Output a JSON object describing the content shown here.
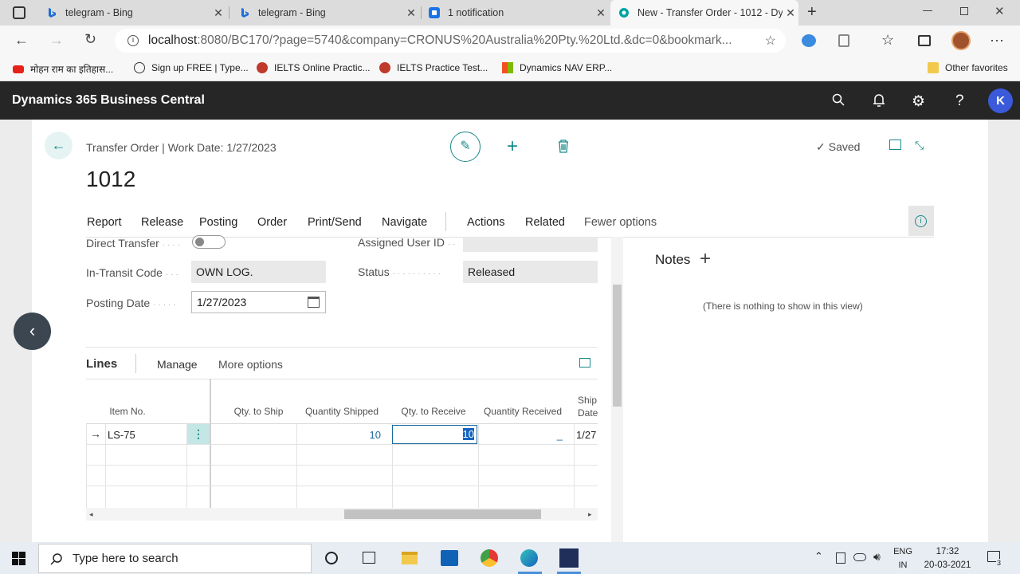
{
  "browser": {
    "tabs": [
      {
        "title": "telegram - Bing"
      },
      {
        "title": "telegram - Bing"
      },
      {
        "title": "1 notification"
      },
      {
        "title": "New - Transfer Order - 1012 - Dy"
      }
    ],
    "url_host": "localhost",
    "url_rest": ":8080/BC170/?page=5740&company=CRONUS%20Australia%20Pty.%20Ltd.&dc=0&bookmark...",
    "favorites": [
      {
        "label": "मोहन राम का इतिहास..."
      },
      {
        "label": "Sign up FREE | Type..."
      },
      {
        "label": "IELTS Online Practic..."
      },
      {
        "label": "IELTS Practice Test..."
      },
      {
        "label": "Dynamics NAV ERP..."
      }
    ],
    "other_favorites": "Other favorites"
  },
  "app": {
    "title": "Dynamics 365 Business Central",
    "avatar_initial": "K"
  },
  "page": {
    "breadcrumb": "Transfer Order | Work Date: 1/27/2023",
    "record_no": "1012",
    "saved": "Saved",
    "actions": [
      "Report",
      "Release",
      "Posting",
      "Order",
      "Print/Send",
      "Navigate",
      "Actions",
      "Related",
      "Fewer options"
    ]
  },
  "fields": {
    "direct_transfer_label": "Direct Transfer",
    "in_transit_label": "In-Transit Code",
    "in_transit_value": "OWN LOG.",
    "posting_date_label": "Posting Date",
    "posting_date_value": "1/27/2023",
    "assigned_user_label": "Assigned User ID",
    "status_label": "Status",
    "status_value": "Released"
  },
  "notes": {
    "title": "Notes",
    "empty": "(There is nothing to show in this view)"
  },
  "lines": {
    "title": "Lines",
    "manage": "Manage",
    "more": "More options",
    "columns": {
      "item_no": "Item No.",
      "qty_ship": "Qty. to Ship",
      "qty_shipped": "Quantity Shipped",
      "qty_receive": "Qty. to Receive",
      "qty_received": "Quantity Received",
      "ship_date_1": "Ship",
      "ship_date_2": "Date"
    },
    "row": {
      "item_no": "LS-75",
      "qty_shipped": "10",
      "qty_receive": "10",
      "qty_received": "_",
      "ship_date": "1/27"
    }
  },
  "taskbar": {
    "search": "Type here to search",
    "lang1": "ENG",
    "lang2": "IN",
    "time": "17:32",
    "date": "20-03-2021",
    "notif": "3"
  }
}
